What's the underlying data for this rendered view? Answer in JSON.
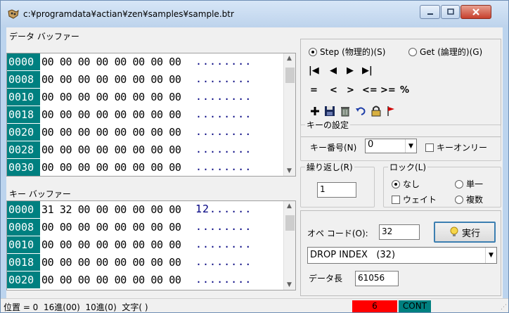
{
  "window": {
    "title": "c:¥programdata¥actian¥zen¥samples¥sample.btr"
  },
  "data_buffer": {
    "label": "データ バッファー",
    "rows": [
      {
        "addr": "0000",
        "bytes": "00 00 00 00 00 00 00 00",
        "ascii": "........"
      },
      {
        "addr": "0008",
        "bytes": "00 00 00 00 00 00 00 00",
        "ascii": "........"
      },
      {
        "addr": "0010",
        "bytes": "00 00 00 00 00 00 00 00",
        "ascii": "........"
      },
      {
        "addr": "0018",
        "bytes": "00 00 00 00 00 00 00 00",
        "ascii": "........"
      },
      {
        "addr": "0020",
        "bytes": "00 00 00 00 00 00 00 00",
        "ascii": "........"
      },
      {
        "addr": "0028",
        "bytes": "00 00 00 00 00 00 00 00",
        "ascii": "........"
      },
      {
        "addr": "0030",
        "bytes": "00 00 00 00 00 00 00 00",
        "ascii": "........"
      }
    ]
  },
  "key_buffer": {
    "label": "キー バッファー",
    "rows": [
      {
        "addr": "0000",
        "bytes": "31 32 00 00 00 00 00 00",
        "ascii": "12......"
      },
      {
        "addr": "0008",
        "bytes": "00 00 00 00 00 00 00 00",
        "ascii": "........"
      },
      {
        "addr": "0010",
        "bytes": "00 00 00 00 00 00 00 00",
        "ascii": "........"
      },
      {
        "addr": "0018",
        "bytes": "00 00 00 00 00 00 00 00",
        "ascii": "........"
      },
      {
        "addr": "0020",
        "bytes": "00 00 00 00 00 00 00 00",
        "ascii": "........"
      }
    ]
  },
  "navigation": {
    "step_label": "Step (物理的)(S)",
    "get_label": "Get (論理的)(G)",
    "selected": "step",
    "nav_buttons": [
      "|◀",
      "◀",
      "▶",
      "▶|"
    ],
    "compare_buttons": [
      "=",
      "<",
      ">",
      "<=",
      ">=",
      "%"
    ]
  },
  "key_settings": {
    "group_label": "キーの設定",
    "key_number_label": "キー番号(N)",
    "key_number_value": "0",
    "key_only_label": "キーオンリー"
  },
  "repeat": {
    "group_label": "繰り返し(R)",
    "value": "1"
  },
  "lock": {
    "group_label": "ロック(L)",
    "none_label": "なし",
    "single_label": "単一",
    "wait_label": "ウェイト",
    "multiple_label": "複数",
    "selected": "none"
  },
  "operation": {
    "op_code_label": "オペ コード(O):",
    "op_code_value": "32",
    "execute_label": "実行",
    "operation_select": "DROP INDEX   (32)",
    "data_length_label": "データ長",
    "data_length_value": "61056"
  },
  "status_bar": {
    "position_text": "位置 = 0  16進(00)  10進(0)  文字( )",
    "status_code": "6",
    "mode": "CONT",
    "status_color": "#ff0000",
    "mode_color": "#008080"
  }
}
